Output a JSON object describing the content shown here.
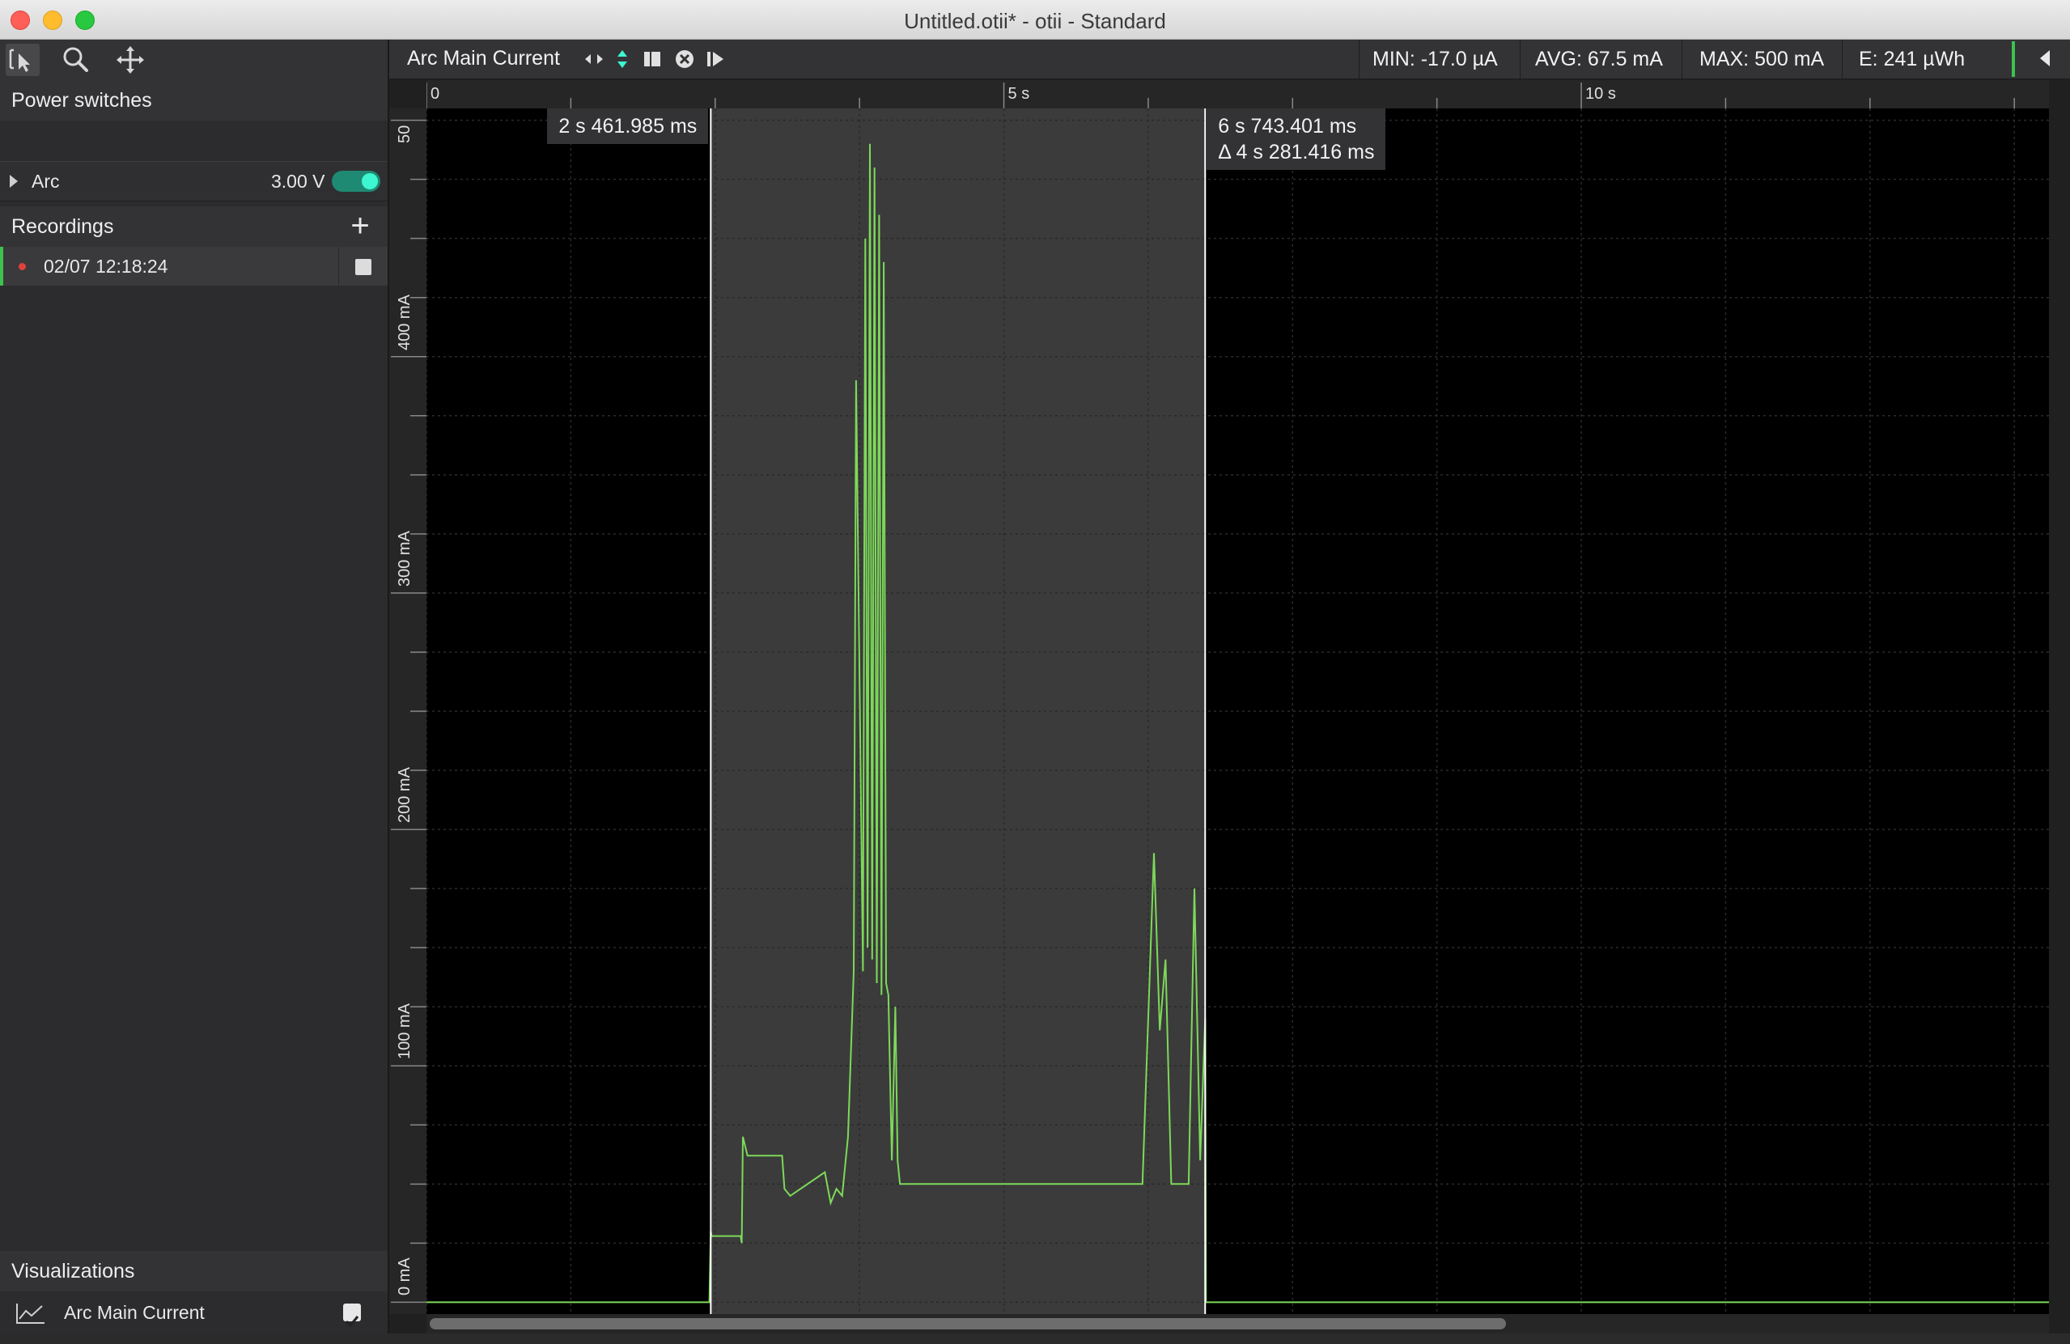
{
  "window": {
    "title": "Untitled.otii* - otii - Standard"
  },
  "toolbar": {
    "tools": [
      "select-tool",
      "zoom-tool",
      "pan-tool"
    ]
  },
  "sidebar": {
    "power_switches": {
      "title": "Power switches",
      "items": [
        {
          "name": "Arc",
          "voltage": "3.00 V",
          "enabled": true
        }
      ]
    },
    "recordings": {
      "title": "Recordings",
      "add_icon": "plus-icon",
      "items": [
        {
          "name": "02/07 12:18:24",
          "status_color": "#e0413d",
          "active": true
        }
      ]
    },
    "visualizations": {
      "title": "Visualizations",
      "items": [
        {
          "name": "Arc Main Current",
          "icon": "line-chart-icon",
          "checked": true
        }
      ]
    }
  },
  "header": {
    "trace_name": "Arc Main Current",
    "controls": [
      "horizontal-fit-icon",
      "vertical-fit-icon",
      "stop-icon",
      "close-circle-icon",
      "play-step-icon"
    ],
    "stats": {
      "min": "MIN: -17.0 µA",
      "avg": "AVG: 67.5 mA",
      "max": "MAX: 500 mA",
      "energy": "E: 241 µWh"
    },
    "accent": "#3cc24d"
  },
  "cursors": {
    "left": "2 s 461.985 ms",
    "right": "6 s 743.401 ms",
    "delta": "Δ 4 s 281.416 ms"
  },
  "chart_data": {
    "type": "line",
    "x_ticks": [
      "0",
      "5 s",
      "10 s"
    ],
    "y_ticks": [
      "0 mA",
      "100 mA",
      "200 mA",
      "300 mA",
      "400 mA",
      "50"
    ],
    "xlim": [
      0,
      14.05
    ],
    "ylim": [
      -5,
      505
    ],
    "line_color": "#7dd95a",
    "selection": {
      "start_s": 2.462,
      "end_s": 6.743
    },
    "series": [
      {
        "x": [
          0,
          2.45,
          2.462,
          2.47,
          2.72,
          2.73,
          2.74,
          2.78,
          3.08,
          3.1,
          3.15,
          3.45,
          3.5,
          3.55,
          3.6,
          3.65,
          3.7,
          3.72,
          3.78,
          3.8,
          3.82,
          3.84,
          3.86,
          3.88,
          3.9,
          3.92,
          3.94,
          3.96,
          3.98,
          4.0,
          4.03,
          4.06,
          4.08,
          4.1,
          6.2,
          6.25,
          6.3,
          6.35,
          6.4,
          6.45,
          6.6,
          6.65,
          6.7,
          6.743,
          6.75,
          14.05
        ],
        "y": [
          0,
          0,
          30,
          28,
          28,
          25,
          70,
          62,
          62,
          48,
          45,
          55,
          42,
          48,
          45,
          70,
          140,
          390,
          140,
          450,
          150,
          490,
          145,
          480,
          135,
          460,
          130,
          440,
          135,
          130,
          60,
          125,
          60,
          50,
          50,
          120,
          190,
          115,
          145,
          50,
          50,
          175,
          60,
          120,
          0,
          0
        ]
      }
    ]
  }
}
